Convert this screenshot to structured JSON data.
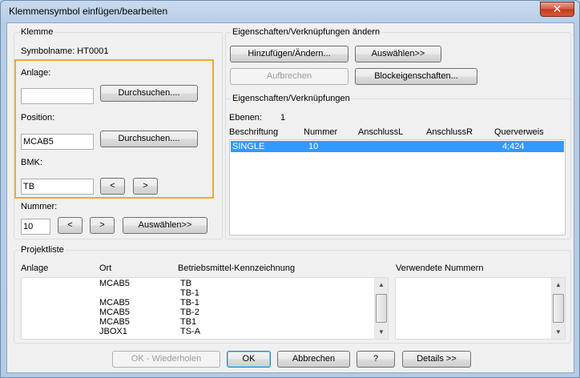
{
  "window": {
    "title": "Klemmensymbol einfügen/bearbeiten",
    "close_glyph": "✕"
  },
  "klemme": {
    "group_title": "Klemme",
    "symbolname_label": "Symbolname: HT0001",
    "anlage_label": "Anlage:",
    "anlage_value": "",
    "browse1": "Durchsuchen....",
    "position_label": "Position:",
    "position_value": "MCAB5",
    "browse2": "Durchsuchen....",
    "bmk_label": "BMK:",
    "bmk_value": "TB",
    "prev": "<",
    "next": ">",
    "nummer_label": "Nummer:",
    "nummer_value": "10",
    "nummer_prev": "<",
    "nummer_next": ">",
    "auswaehlen": "Auswählen>>"
  },
  "eigenschaften_aendern": {
    "group_title": "Eigenschaften/Verknüpfungen ändern",
    "add_change": "Hinzufügen/Ändern...",
    "select": "Auswählen>>",
    "break": "Aufbrechen",
    "block_props": "Blockeigenschaften..."
  },
  "eigenschaften": {
    "group_title": "Eigenschaften/Verknüpfungen",
    "ebenen_label": "Ebenen:",
    "ebenen_value": "1",
    "columns": [
      "Beschriftung",
      "Nummer",
      "AnschlussL",
      "AnschlussR",
      "Querverweis"
    ],
    "rows": [
      {
        "beschriftung": "SINGLE",
        "nummer": "10",
        "anschlussL": "",
        "anschlussR": "",
        "querverweis": "4;424",
        "selected": true
      }
    ]
  },
  "projektliste": {
    "group_title": "Projektliste",
    "columns": [
      "Anlage",
      "Ort",
      "Betriebsmittel-Kennzeichnung"
    ],
    "used_numbers_header": "Verwendete Nummern",
    "rows": [
      {
        "anlage": "",
        "ort": "MCAB5",
        "bmk": "TB"
      },
      {
        "anlage": "",
        "ort": "",
        "bmk": "TB-1"
      },
      {
        "anlage": "",
        "ort": "MCAB5",
        "bmk": "TB-1"
      },
      {
        "anlage": "",
        "ort": "MCAB5",
        "bmk": "TB-2"
      },
      {
        "anlage": "",
        "ort": "MCAB5",
        "bmk": "TB1"
      },
      {
        "anlage": "",
        "ort": "JBOX1",
        "bmk": "TS-A"
      }
    ]
  },
  "footer": {
    "ok_repeat": "OK - Wiederholen",
    "ok": "OK",
    "cancel": "Abbrechen",
    "help": "?",
    "details": "Details >>"
  },
  "scroll": {
    "up_glyph": "▲",
    "down_glyph": "▼"
  },
  "colors": {
    "selection": "#3399ff",
    "highlight_border": "#f0a830"
  }
}
